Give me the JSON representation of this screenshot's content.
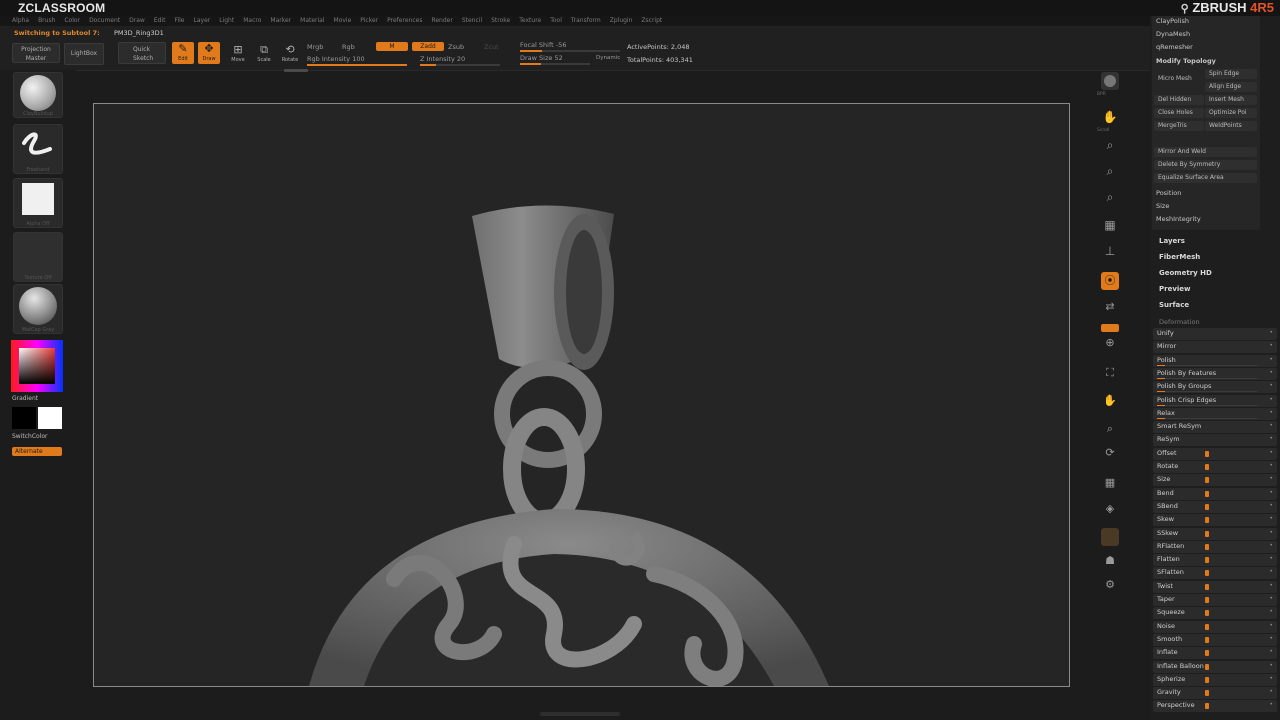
{
  "titlebar": {
    "brand": "ZCLASSROOM",
    "app_logo": "ZBRUSH",
    "app_version": "4R5"
  },
  "menu": [
    "Alpha",
    "Brush",
    "Color",
    "Document",
    "Draw",
    "Edit",
    "File",
    "Layer",
    "Light",
    "Macro",
    "Marker",
    "Material",
    "Movie",
    "Picker",
    "Preferences",
    "Render",
    "Stencil",
    "Stroke",
    "Texture",
    "Tool",
    "Transform",
    "Zplugin",
    "Zscript"
  ],
  "toolbar": {
    "status": "Switching to Subtool 7:",
    "subtool_name": "PM3D_Ring3D1",
    "projection_master": "Projection Master",
    "lightbox": "LightBox",
    "quick_sketch": "Quick Sketch",
    "edit": "Edit",
    "draw": "Draw",
    "move": "Move",
    "scale": "Scale",
    "rotate": "Rotate",
    "mrgb": "Mrgb",
    "rgb": "Rgb",
    "m": "M",
    "zadd": "Zadd",
    "zsub": "Zsub",
    "zcut": "Zcut",
    "rgb_intensity": "Rgb Intensity 100",
    "z_intensity": "Z Intensity 20",
    "focal_shift": "Focal Shift -56",
    "draw_size": "Draw Size 52",
    "dynamic": "Dynamic",
    "active_points": "ActivePoints: 2,048",
    "total_points": "TotalPoints: 403,341",
    "rgb_intensity_level": 1.0,
    "z_intensity_level": 0.2
  },
  "left_shelf": {
    "brush_label": "ClayBuildup",
    "stroke_label": "Freehand",
    "alpha_label": "Alpha Off",
    "texture_label": "Texture Off",
    "material_label": "MatCap Gray",
    "gradient": "Gradient",
    "switch_color": "SwitchColor",
    "alternate": "Alternate"
  },
  "right_shelf": [
    "BPR",
    "Scroll",
    "Zoom",
    "Actual",
    "AAHalf",
    "Persp",
    "Floor",
    "Local",
    "L.Sym",
    "XYZ",
    "Frame",
    "Move",
    "Scale",
    "Rotate",
    "PolyF",
    "Transp",
    "Ghost",
    "Solo",
    "Xpose"
  ],
  "right_panel": {
    "geometry_buttons": [
      "ClayPolish",
      "DynaMesh",
      "qRemesher",
      "Modify Topology"
    ],
    "micro_mesh": "Micro Mesh",
    "spin_edge": "Spin Edge",
    "align_edge": "Align Edge",
    "del_hidden": "Del Hidden",
    "insert_mesh": "Insert Mesh",
    "close_holes": "Close Holes",
    "optimize_points": "Optimize Poi",
    "merge_tris": "MergeTris",
    "weld_points": "WeldPoints",
    "mirror_and_weld": "Mirror And Weld",
    "delete_by_symmetry": "Delete By Symmetry",
    "equalize_surface_area": "Equalize Surface Area",
    "position": "Position",
    "size": "Size",
    "mesh_integrity": "MeshIntegrity",
    "sections": [
      "Layers",
      "FiberMesh",
      "Geometry HD",
      "Preview",
      "Surface"
    ],
    "deformation_header": "Deformation",
    "deformation_items": [
      "Unify",
      "Mirror",
      "Polish",
      "Polish By Features",
      "Polish By Groups",
      "Polish Crisp Edges",
      "Relax",
      "Smart ReSym",
      "ReSym",
      "Offset",
      "Rotate",
      "Size",
      "Bend",
      "SBend",
      "Skew",
      "SSkew",
      "RFlatten",
      "Flatten",
      "SFlatten",
      "Twist",
      "Taper",
      "Squeeze",
      "Noise",
      "Smooth",
      "Inflate",
      "Inflate Balloon",
      "Spherize",
      "Gravity",
      "Perspective"
    ]
  },
  "colors": {
    "accent": "#e07a1a",
    "bg": "#1c1c1c",
    "canvas": "#252525",
    "logo_version": "#e2532a"
  }
}
